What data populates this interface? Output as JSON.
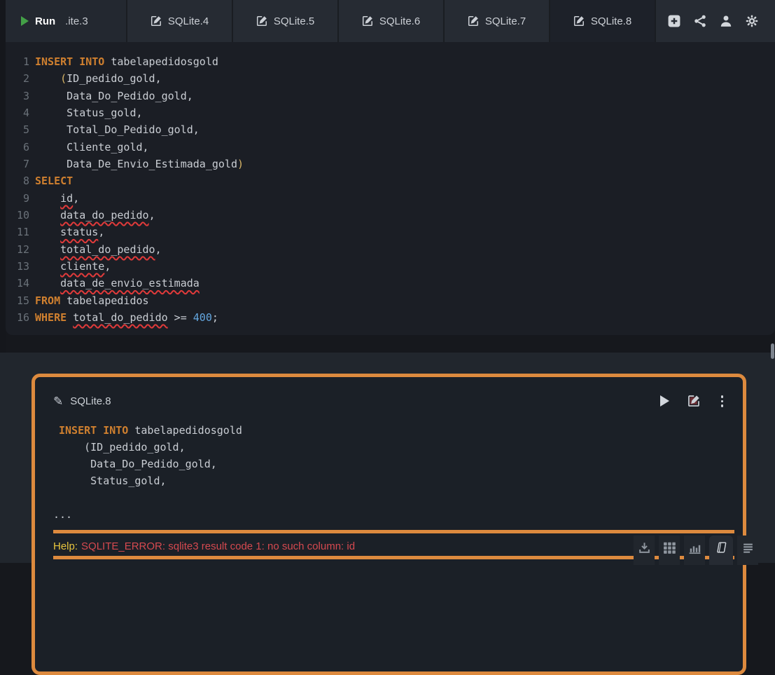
{
  "topbar": {
    "run_label": "Run",
    "first_tab_label": ".ite.3",
    "tabs": [
      {
        "label": "SQLite.4",
        "active": false
      },
      {
        "label": "SQLite.5",
        "active": false
      },
      {
        "label": "SQLite.6",
        "active": false
      },
      {
        "label": "SQLite.7",
        "active": false
      },
      {
        "label": "SQLite.8",
        "active": true
      }
    ],
    "actions": [
      {
        "icon": "plus-square-icon"
      },
      {
        "icon": "share-icon"
      },
      {
        "icon": "user-icon"
      },
      {
        "icon": "gear-icon"
      }
    ]
  },
  "editor": {
    "lines": [
      {
        "num": "1",
        "segs": [
          [
            "k",
            "INSERT INTO"
          ],
          [
            "p",
            " tabelapedidosgold"
          ]
        ]
      },
      {
        "num": "2",
        "segs": [
          [
            "p",
            "    "
          ],
          [
            "b",
            "("
          ],
          [
            "p",
            "ID_pedido_gold,"
          ]
        ]
      },
      {
        "num": "3",
        "segs": [
          [
            "p",
            "     Data_Do_Pedido_gold,"
          ]
        ]
      },
      {
        "num": "4",
        "segs": [
          [
            "p",
            "     Status_gold,"
          ]
        ]
      },
      {
        "num": "5",
        "segs": [
          [
            "p",
            "     Total_Do_Pedido_gold,"
          ]
        ]
      },
      {
        "num": "6",
        "segs": [
          [
            "p",
            "     Cliente_gold,"
          ]
        ]
      },
      {
        "num": "7",
        "segs": [
          [
            "p",
            "     Data_De_Envio_Estimada_gold"
          ],
          [
            "b",
            ")"
          ]
        ]
      },
      {
        "num": "8",
        "segs": [
          [
            "k",
            "SELECT"
          ]
        ]
      },
      {
        "num": "9",
        "segs": [
          [
            "p",
            "    "
          ],
          [
            "e",
            "id"
          ],
          [
            "p",
            ","
          ]
        ]
      },
      {
        "num": "10",
        "segs": [
          [
            "p",
            "    "
          ],
          [
            "e",
            "data_do_pedido"
          ],
          [
            "p",
            ","
          ]
        ]
      },
      {
        "num": "11",
        "segs": [
          [
            "p",
            "    "
          ],
          [
            "e",
            "status"
          ],
          [
            "p",
            ","
          ]
        ]
      },
      {
        "num": "12",
        "segs": [
          [
            "p",
            "    "
          ],
          [
            "e",
            "total_do_pedido"
          ],
          [
            "p",
            ","
          ]
        ]
      },
      {
        "num": "13",
        "segs": [
          [
            "p",
            "    "
          ],
          [
            "e",
            "cliente"
          ],
          [
            "p",
            ","
          ]
        ]
      },
      {
        "num": "14",
        "segs": [
          [
            "p",
            "    "
          ],
          [
            "e",
            "data_de_envio_estimada"
          ]
        ]
      },
      {
        "num": "15",
        "segs": [
          [
            "k",
            "FROM"
          ],
          [
            "p",
            " tabelapedidos"
          ]
        ]
      },
      {
        "num": "16",
        "segs": [
          [
            "k",
            "WHERE"
          ],
          [
            "p",
            " "
          ],
          [
            "e",
            "total_do_pedido"
          ],
          [
            "p",
            " >= "
          ],
          [
            "n",
            "400"
          ],
          [
            "p",
            ";"
          ]
        ]
      }
    ]
  },
  "result_card": {
    "title": "SQLite.8",
    "title_icon": "pencil-icon",
    "actions": [
      {
        "icon": "play-icon"
      },
      {
        "icon": "edit-icon"
      },
      {
        "icon": "kebab-menu-icon"
      }
    ],
    "code_lines": [
      [
        [
          "k",
          "INSERT INTO"
        ],
        [
          "p",
          " tabelapedidosgold"
        ]
      ],
      [
        [
          "p",
          "    (ID_pedido_gold,"
        ]
      ],
      [
        [
          "p",
          "     Data_Do_Pedido_gold,"
        ]
      ],
      [
        [
          "p",
          "     Status_gold,"
        ]
      ]
    ],
    "ellipsis": "...",
    "error": {
      "label": "Help:",
      "message": "SQLITE_ERROR: sqlite3 result code 1: no such column: id"
    },
    "footer_icons": [
      {
        "icon": "download-icon",
        "active": false
      },
      {
        "icon": "table-icon",
        "active": false
      },
      {
        "icon": "chart-icon",
        "active": false
      },
      {
        "icon": "book-icon",
        "active": true
      },
      {
        "icon": "list-icon",
        "active": false
      }
    ]
  },
  "colors": {
    "accent_orange": "#dd8a3e",
    "keyword_orange": "#d0802f",
    "number_blue": "#64a7e0",
    "error_red": "#d5494f",
    "help_yellow": "#e9c63e",
    "run_green": "#43a047",
    "squiggle_red": "#e03a3a"
  }
}
